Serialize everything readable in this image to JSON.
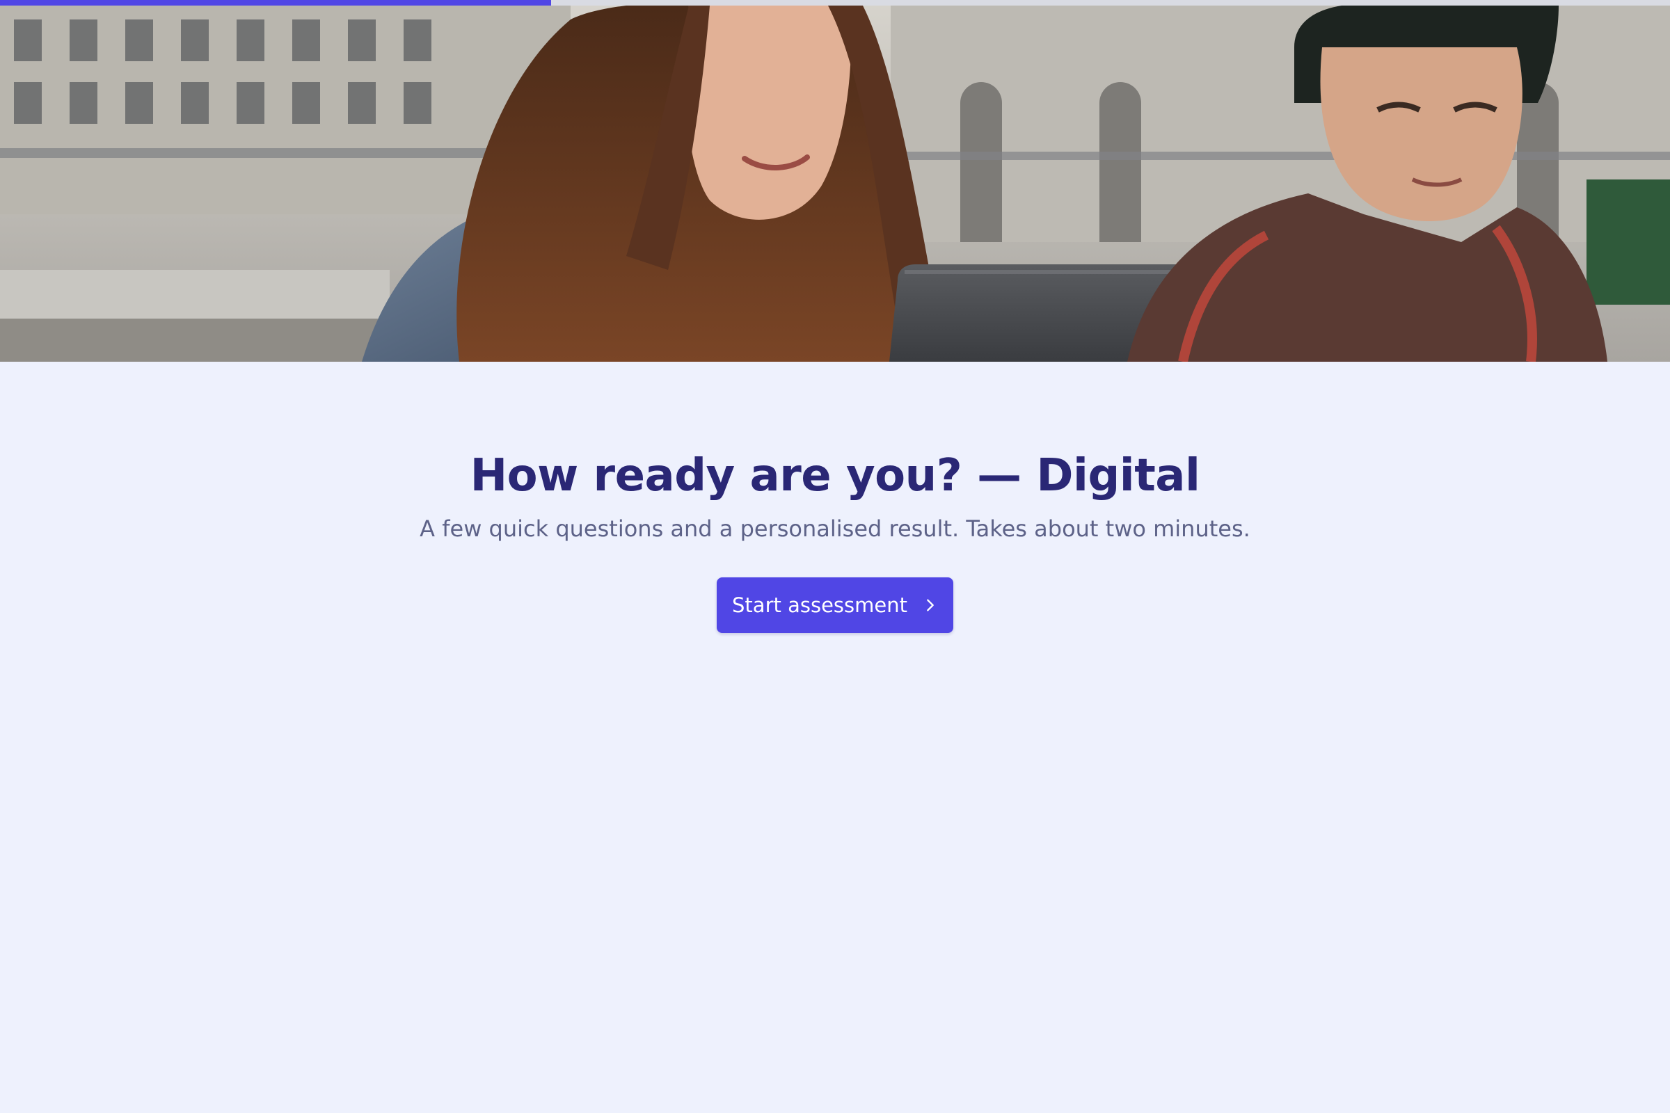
{
  "progress": {
    "value_percent": 33
  },
  "hero": {
    "image_alt": "",
    "icon": "photo"
  },
  "main": {
    "title": "How ready are you? — Digital",
    "subtitle": "A few quick questions and a personalised result. Takes about two minutes.",
    "cta_label": "Start assessment",
    "cta_icon": "chevron-right-icon"
  },
  "colors": {
    "accent": "#5046e5",
    "background": "#eef1fd",
    "title": "#2a2775",
    "subtitle": "#5d6288",
    "track": "#d9dbe3"
  }
}
